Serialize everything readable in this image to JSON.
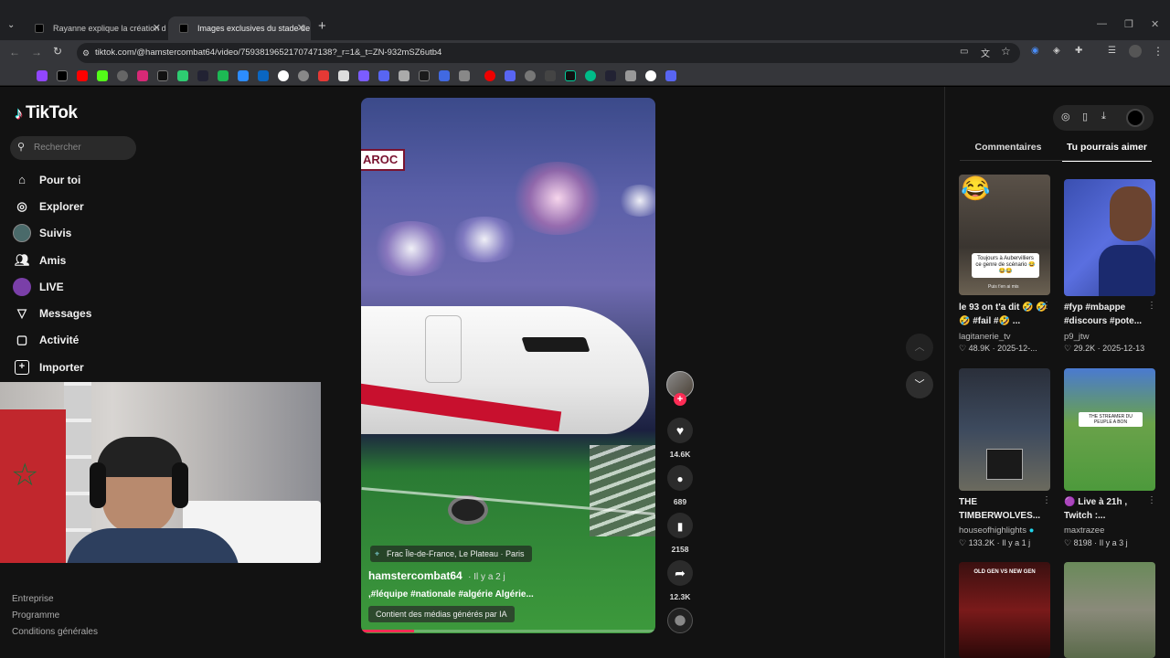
{
  "browser": {
    "tabs": [
      {
        "title": "Rayanne explique la création d"
      },
      {
        "title": "Images exclusives du stade de"
      }
    ],
    "url": "tiktok.com/@hamstercombat64/video/7593819652170747138?_r=1&_t=ZN-932mSZ6utb4"
  },
  "sidebar": {
    "logo": "TikTok",
    "search_placeholder": "Rechercher",
    "items": [
      {
        "label": "Pour toi",
        "icon": "home-icon"
      },
      {
        "label": "Explorer",
        "icon": "compass-icon"
      },
      {
        "label": "Suivis",
        "icon": "following-icon"
      },
      {
        "label": "Amis",
        "icon": "friends-icon"
      },
      {
        "label": "LIVE",
        "icon": "live-icon"
      },
      {
        "label": "Messages",
        "icon": "messages-icon"
      },
      {
        "label": "Activité",
        "icon": "activity-icon"
      },
      {
        "label": "Importer",
        "icon": "upload-icon"
      }
    ],
    "footer": [
      "Entreprise",
      "Programme",
      "Conditions générales"
    ]
  },
  "video": {
    "location": "Frac Île-de-France, Le Plateau · Paris",
    "username": "hamstercombat64",
    "time": "· Il y a 2 j",
    "caption": ",#léquipe #nationale #algérie Algérie...",
    "ai_label": "Contient des médias générés par IA",
    "overlay_text": "AROC",
    "progress": 0.18
  },
  "actions": {
    "likes": "14.6K",
    "comments": "689",
    "saves": "2158",
    "shares": "12.3K"
  },
  "right_panel": {
    "tabs": [
      "Commentaires",
      "Tu pourrais aimer"
    ],
    "active_tab": 1,
    "cards": [
      {
        "title": "le 93 on t'a dit 🤣 🤣🤣 #fail #🤣 ...",
        "author": "lagitanerie_tv",
        "likes": "48.9K",
        "date": "2025-12-..."
      },
      {
        "title": "#fyp #mbappe #discours #pote...",
        "author": "p9_jtw",
        "likes": "29.2K",
        "date": "2025-12-13"
      },
      {
        "title": "THE TIMBERWOLVES...",
        "author": "houseofhighlights",
        "likes": "133.2K",
        "date": "Il y a 1 j"
      },
      {
        "title": "🟣 Live à 21h , Twitch :...",
        "author": "maxtrazee",
        "likes": "8198",
        "date": "Il y a 3 j"
      }
    ],
    "thumb_texts": [
      "Toujours à Aubervilliers ce genre de scénario 😂😂😂",
      "Puis t'en ai mis",
      "THE STREAMER DU PEUPLE A BON",
      "OLD GEN VS NEW GEN"
    ]
  },
  "colors": {
    "accent": "#fe2c55",
    "bg": "#121212"
  }
}
